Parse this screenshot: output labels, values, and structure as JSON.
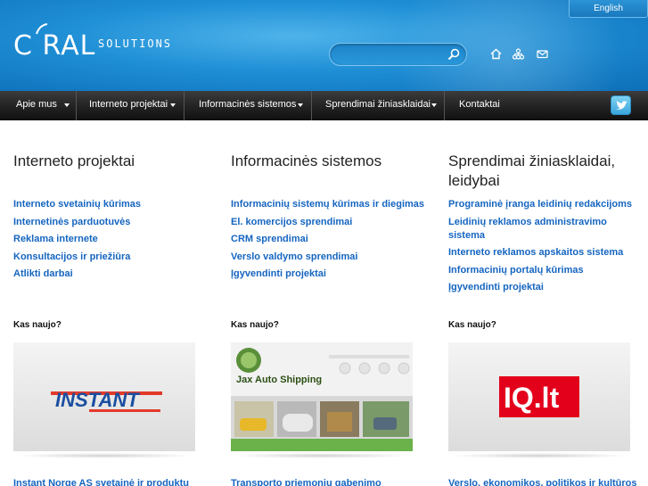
{
  "header": {
    "logo_main": "C RAL",
    "logo_sub": "SOLUTIONS",
    "language_button": "English",
    "search": {
      "placeholder": "",
      "value": ""
    },
    "icons": [
      "home-icon",
      "sitemap-icon",
      "mail-icon",
      "search-icon"
    ]
  },
  "nav": {
    "items": [
      {
        "label": "Apie mus"
      },
      {
        "label": "Interneto projektai"
      },
      {
        "label": "Informacinės sistemos"
      },
      {
        "label": "Sprendimai žiniasklaidai"
      },
      {
        "label": "Kontaktai"
      }
    ],
    "twitter_icon": "twitter-icon"
  },
  "columns": [
    {
      "title": "Interneto projektai",
      "links": [
        "Interneto svetainių kūrimas",
        "Internetinės parduotuvės",
        "Reklama internete",
        "Konsultacijos ir priežiūra",
        "Atlikti darbai"
      ],
      "news_label": "Kas naujo?",
      "thumb_text": "INSTANT",
      "caption": "Instant Norge AS svetainė ir produktų"
    },
    {
      "title": "Informacinės sistemos",
      "links": [
        "Informacinių sistemų kūrimas ir diegimas",
        "El. komercijos sprendimai",
        "CRM sprendimai",
        "Verslo valdymo sprendimai",
        "Įgyvendinti projektai"
      ],
      "news_label": "Kas naujo?",
      "thumb_text": "Jax Auto Shipping",
      "caption": "Transporto priemonių gabenimo"
    },
    {
      "title": "Sprendimai žiniasklaidai, leidybai",
      "links": [
        "Programinė įranga leidinių redakcijoms",
        "Leidinių reklamos administravimo sistema",
        "Interneto reklamos apskaitos sistema",
        "Informacinių portalų kūrimas",
        "Įgyvendinti projektai"
      ],
      "news_label": "Kas naujo?",
      "thumb_text": "IQ.lt",
      "caption": "Verslo, ekonomikos, politikos ir kultūros"
    }
  ],
  "colors": {
    "link": "#1565c0",
    "header_blue": "#1f8fd6",
    "nav_dark": "#242424"
  }
}
